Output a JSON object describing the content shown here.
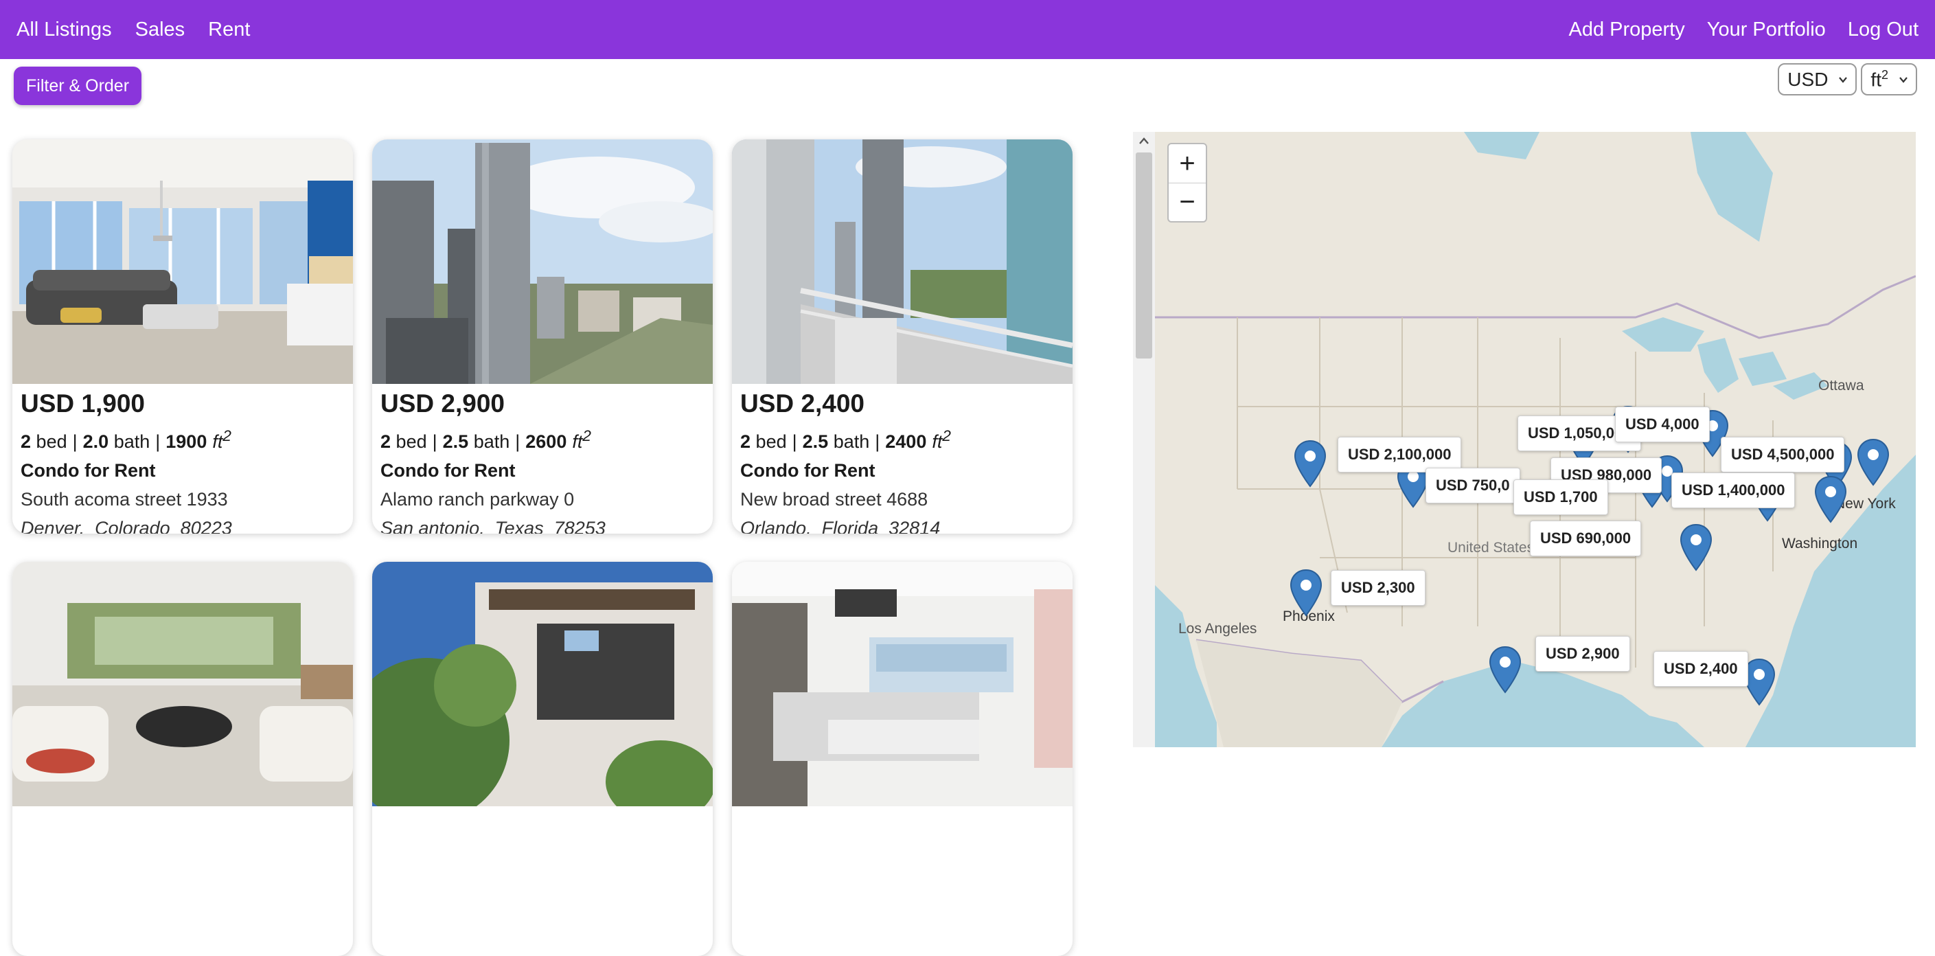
{
  "nav": {
    "left": [
      "All Listings",
      "Sales",
      "Rent"
    ],
    "right": [
      "Add Property",
      "Your Portfolio",
      "Log Out"
    ]
  },
  "toolbar": {
    "filter_label": "Filter & Order",
    "currency": "USD",
    "unit_base": "ft",
    "unit_sup": "2"
  },
  "listings": [
    {
      "price": "USD 1,900",
      "beds": "2",
      "beds_label": "bed",
      "baths": "2.0",
      "baths_label": "bath",
      "area": "1900",
      "unit": "ft",
      "unit_sup": "2",
      "type": "Condo for Rent",
      "street": "South acoma street 1933",
      "city": "Denver,",
      "state": "Colorado",
      "zip": "80223"
    },
    {
      "price": "USD 2,900",
      "beds": "2",
      "beds_label": "bed",
      "baths": "2.5",
      "baths_label": "bath",
      "area": "2600",
      "unit": "ft",
      "unit_sup": "2",
      "type": "Condo for Rent",
      "street": "Alamo ranch parkway 0",
      "city": "San antonio,",
      "state": "Texas",
      "zip": "78253"
    },
    {
      "price": "USD 2,400",
      "beds": "2",
      "beds_label": "bed",
      "baths": "2.5",
      "baths_label": "bath",
      "area": "2400",
      "unit": "ft",
      "unit_sup": "2",
      "type": "Condo for Rent",
      "street": "New broad street 4688",
      "city": "Orlando,",
      "state": "Florida",
      "zip": "32814"
    }
  ],
  "map": {
    "zoom_in": "+",
    "zoom_out": "−",
    "place_labels": [
      "Ottawa",
      "New York",
      "Washington",
      "United States",
      "Los Angeles",
      "Phoenix"
    ],
    "price_labels": [
      "USD 2,100,000",
      "USD 1,050,000",
      "USD 4,000",
      "USD 4,500,000",
      "USD 750,0",
      "USD 980,000",
      "USD 1,700",
      "USD 1,400,000",
      "USD 690,000",
      "USD 2,300",
      "USD 2,900",
      "USD 2,400"
    ],
    "pin_color": "#3d7fc4"
  },
  "colors": {
    "brand": "#8a35db"
  }
}
